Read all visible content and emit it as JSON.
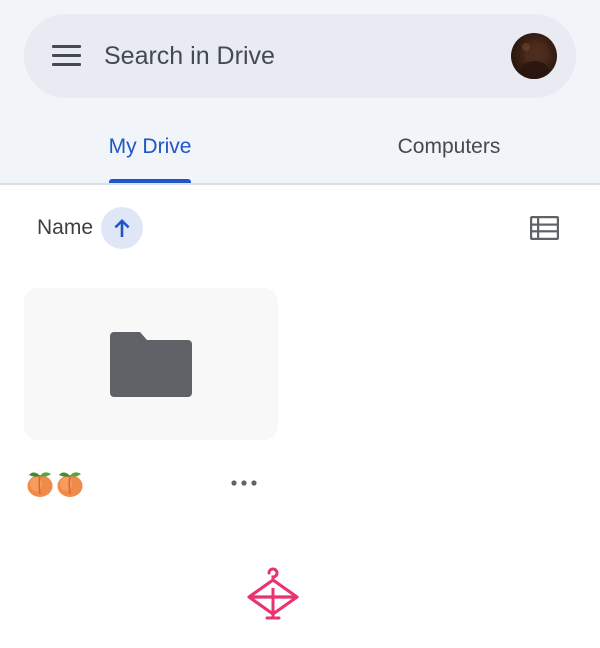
{
  "search": {
    "placeholder": "Search in Drive",
    "menu_icon": "menu-icon",
    "avatar": "account-avatar"
  },
  "tabs": [
    {
      "label": "My Drive",
      "active": true
    },
    {
      "label": "Computers",
      "active": false
    }
  ],
  "sort": {
    "label": "Name",
    "direction_icon": "arrow-up-icon",
    "view_icon": "list-view-icon"
  },
  "files": [
    {
      "type": "folder",
      "name_icons": [
        "peach-emoji",
        "peach-emoji"
      ],
      "more_icon": "more-horizontal-icon"
    }
  ],
  "bottom": {
    "logo_icon": "hanger-logo-icon"
  },
  "colors": {
    "accent": "#1f55c7",
    "header_bg": "#f1f4f9",
    "search_bg": "#e8ecf2",
    "folder_icon": "#5f6368",
    "logo_pink": "#e8336f",
    "peach": "#f08a4b"
  }
}
